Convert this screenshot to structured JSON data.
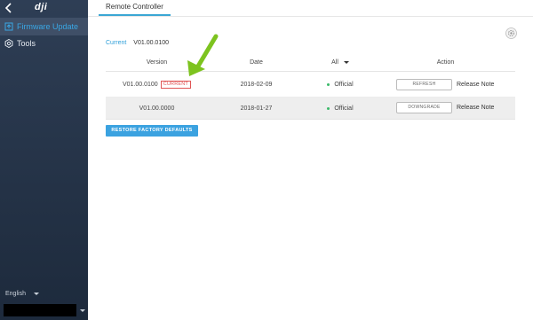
{
  "sidebar": {
    "logo": "dji",
    "items": [
      {
        "label": "Firmware Update",
        "icon": "firmware-icon",
        "active": true
      },
      {
        "label": "Tools",
        "icon": "gear-icon",
        "active": false
      }
    ],
    "language": "English"
  },
  "main": {
    "tab": "Remote Controller",
    "current": {
      "label": "Current",
      "value": "V01.00.0100"
    },
    "table": {
      "headers": {
        "version": "Version",
        "date": "Date",
        "filter": "All",
        "action": "Action"
      },
      "rows": [
        {
          "version": "V01.00.0100",
          "badge": "CURRENT",
          "date": "2018-02-09",
          "type": "Official",
          "button": "REFRESH",
          "note": "Release Note"
        },
        {
          "version": "V01.00.0000",
          "badge": "",
          "date": "2018-01-27",
          "type": "Official",
          "button": "DOWNGRADE",
          "note": "Release Note"
        }
      ]
    },
    "restore_button": "RESTORE FACTORY DEFAULTS"
  },
  "colors": {
    "accent": "#3ba2e0",
    "sidebar": "#26354b",
    "badge": "#e05555",
    "status": "#3cba6a",
    "arrow": "#7dc31f"
  }
}
